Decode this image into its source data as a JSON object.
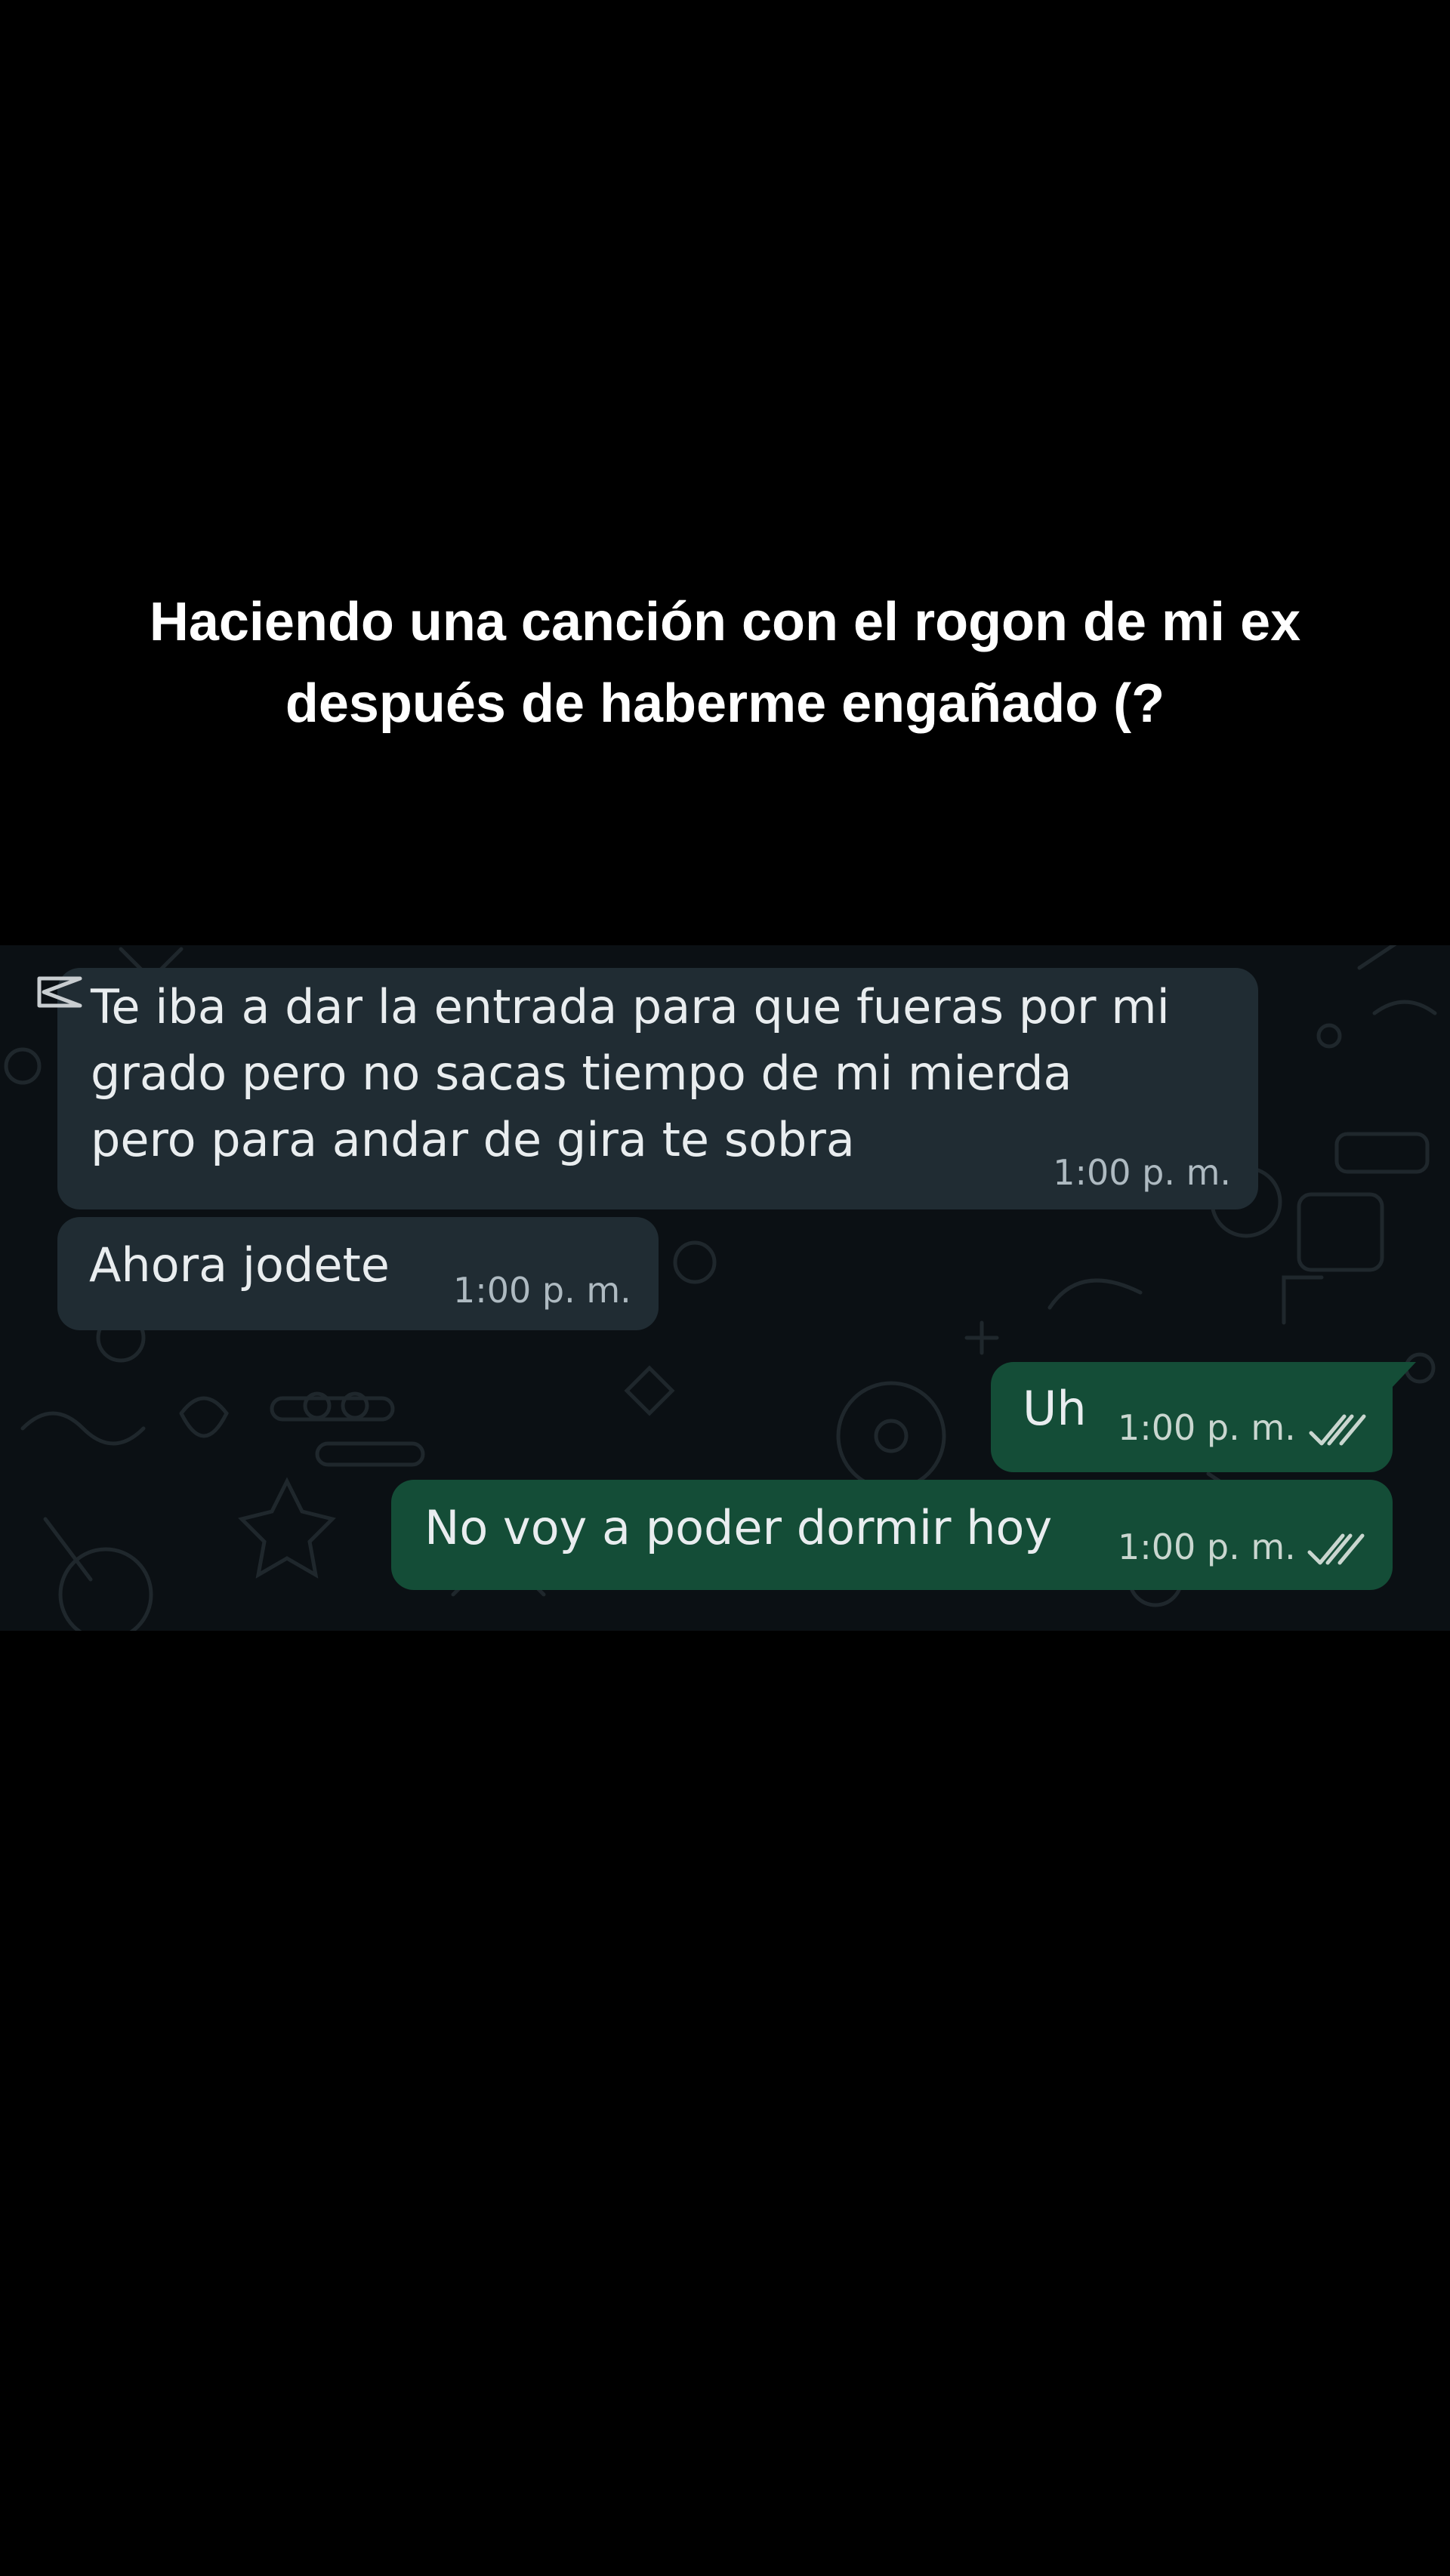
{
  "caption": {
    "line1": "Haciendo una canción con el rogon de mi ex",
    "line2": "después de haberme engañado (?"
  },
  "chat": {
    "colors": {
      "background": "#0b1014",
      "incoming_bubble": "#202c33",
      "outgoing_bubble": "#144d37",
      "read_ticks": "#aebac1"
    },
    "messages": [
      {
        "direction": "incoming",
        "lines": [
          "Te iba a dar la entrada para que fueras por mi",
          "grado pero no sacas tiempo de mi mierda",
          "pero para andar de gira te sobra"
        ],
        "time": "1:00 p. m."
      },
      {
        "direction": "incoming",
        "text": "Ahora jodete",
        "time": "1:00 p. m."
      },
      {
        "direction": "outgoing",
        "text": "Uh",
        "time": "1:00 p. m.",
        "status_icon": "double-check-icon"
      },
      {
        "direction": "outgoing",
        "text": "No voy a poder dormir hoy",
        "time": "1:00 p. m.",
        "status_icon": "double-check-icon"
      }
    ]
  },
  "watermark_icon": "capcut-logo-icon"
}
